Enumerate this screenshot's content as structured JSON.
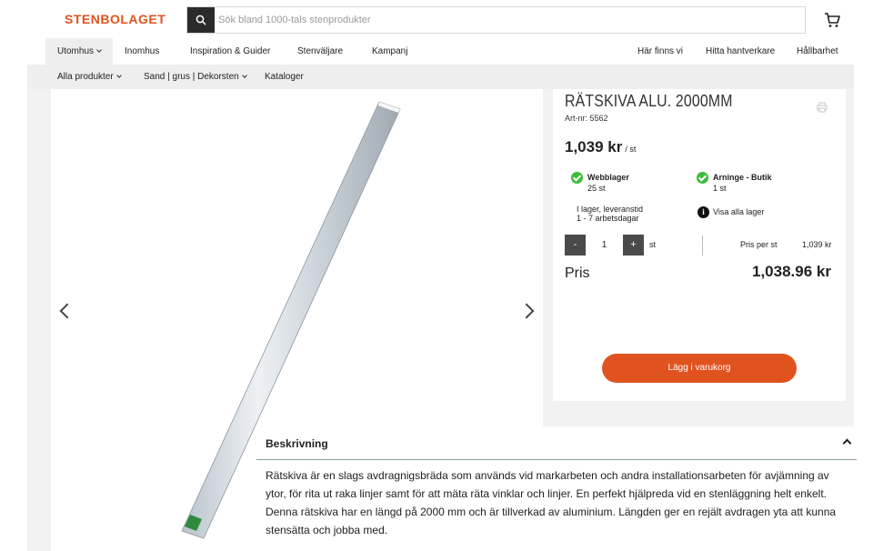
{
  "brand": {
    "logo_text": "STENBOLAGET",
    "accent": "#e0531f"
  },
  "search": {
    "placeholder": "Sök bland 1000-tals stenprodukter",
    "icon": "search-icon"
  },
  "main_nav": [
    {
      "label": "Utomhus"
    },
    {
      "label": "Inomhus"
    },
    {
      "label": "Inspiration & Guider"
    },
    {
      "label": "Stenväljare"
    },
    {
      "label": "Kampanj"
    },
    {
      "label": "Här finns vi"
    },
    {
      "label": "Hitta hantverkare"
    },
    {
      "label": "Hållbarhet"
    }
  ],
  "sub_nav": [
    {
      "label": "Alla produkter"
    },
    {
      "label": "Sand | grus | Dekorsten"
    },
    {
      "label": "Kataloger"
    }
  ],
  "product": {
    "title": "RÄTSKIVA ALU. 2000MM",
    "art_nr": "Art-nr: 5562",
    "price": "1,039 kr",
    "price_unit": "/ st",
    "stock": [
      {
        "name": "Webblager",
        "qty": "25 st"
      },
      {
        "name": "Arninge - Butik",
        "qty": "1 st"
      }
    ],
    "delivery_line1": "I lager, leveranstid",
    "delivery_line2": "1 - 7 arbetsdagar",
    "all_stock_link": "Visa alla lager",
    "qty_minus": "-",
    "qty_plus": "+",
    "qty_value": "1",
    "qty_unit": "st",
    "price_per_label": "Pris per st",
    "price_per_value": "1,039 kr",
    "total_label": "Pris",
    "total_value": "1,038.96 kr",
    "add_to_cart": "Lägg i varukorg"
  },
  "description": {
    "heading": "Beskrivning",
    "text": "Rätskiva är en slags avdragnigsbräda som används vid markarbeten och andra installationsarbeten för avjämning av ytor, för rita ut raka linjer samt för att mäta räta vinklar och linjer. En perfekt hjälpreda vid en stenläggning helt enkelt. Denna rätskiva har en längd på 2000 mm och är tillverkad av aluminium. Längden ger en rejält avdragen yta att kunna stensätta och jobba med."
  }
}
